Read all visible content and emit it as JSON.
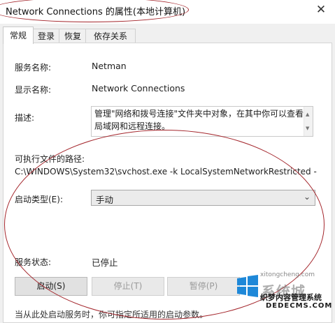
{
  "window": {
    "title": "Network Connections 的属性(本地计算机)",
    "close_glyph": "✕"
  },
  "tabs": [
    {
      "label": "常规",
      "active": true
    },
    {
      "label": "登录",
      "active": false
    },
    {
      "label": "恢复",
      "active": false
    },
    {
      "label": "依存关系",
      "active": false
    }
  ],
  "general": {
    "service_name_label": "服务名称:",
    "service_name_value": "Netman",
    "display_name_label": "显示名称:",
    "display_name_value": "Network Connections",
    "description_label": "描述:",
    "description_value": "管理\"网络和拨号连接\"文件夹中对象，在其中你可以查看局域网和远程连接。",
    "path_label": "可执行文件的路径:",
    "path_value": "C:\\WINDOWS\\System32\\svchost.exe -k LocalSystemNetworkRestricted -",
    "startup_type_label": "启动类型(E):",
    "startup_type_value": "手动",
    "service_status_label": "服务状态:",
    "service_status_value": "已停止",
    "buttons": {
      "start": "启动(S)",
      "stop": "停止(T)",
      "pause": "暂停(P)"
    },
    "note": "当从此处启动服务时，你可指定所适用的启动参数。"
  },
  "watermark": {
    "site_text": "xitongcheng.com",
    "brand": "系统城",
    "sub1": "织梦内容管理系统",
    "sub2": "DEDECMS.COM"
  },
  "colors": {
    "annotation": "#a4262c",
    "windows_logo": "#1e88d8",
    "watermark_sub": "#1a1a1a"
  }
}
